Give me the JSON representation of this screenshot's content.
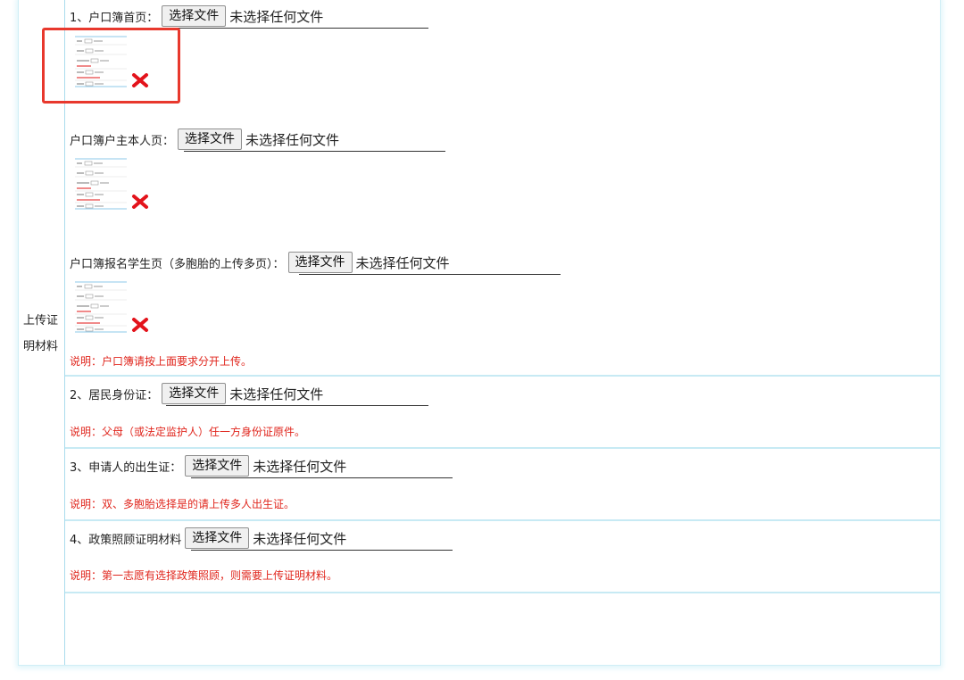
{
  "left_label": "上传证明材料",
  "file_button_label": "选择文件",
  "no_file_text": "未选择任何文件",
  "sections": [
    {
      "uploads": [
        {
          "label": "1、户口簿首页："
        },
        {
          "label": "户口簿户主本人页："
        },
        {
          "label": "户口簿报名学生页（多胞胎的上传多页）："
        }
      ],
      "note": "说明：户口簿请按上面要求分开上传。"
    },
    {
      "uploads": [
        {
          "label": "2、居民身份证："
        }
      ],
      "note": "说明：父母（或法定监护人）任一方身份证原件。"
    },
    {
      "uploads": [
        {
          "label": "3、申请人的出生证："
        }
      ],
      "note": "说明：双、多胞胎选择是的请上传多人出生证。"
    },
    {
      "uploads": [
        {
          "label": "4、政策照顾证明材料"
        }
      ],
      "note": "说明：第一志愿有选择政策照顾，则需要上传证明材料。"
    }
  ],
  "colors": {
    "note_red": "#e0261d",
    "border_blue": "#a9dcec",
    "highlight_red": "#e8382d",
    "delete_red": "#e3131b"
  },
  "icons": {
    "delete": "red-x-delete-icon",
    "thumbnail": "uploaded-image-thumbnail"
  }
}
